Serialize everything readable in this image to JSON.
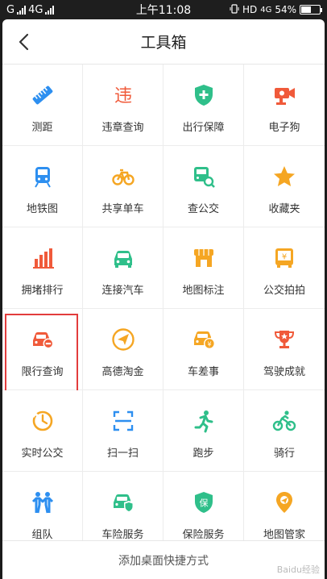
{
  "status_bar": {
    "carrier_left": "G",
    "network": "4G",
    "time": "上午11:08",
    "hd": "HD",
    "network_right": "4G",
    "battery_level_percent": 54,
    "battery_label": "54%"
  },
  "navbar": {
    "title": "工具箱",
    "back_icon": "chevron-left-icon"
  },
  "tools": [
    {
      "label": "测距",
      "icon": "ruler-icon",
      "color": "#2d8ff0"
    },
    {
      "label": "违章查询",
      "icon": "violation-icon",
      "color": "#f05a3a"
    },
    {
      "label": "出行保障",
      "icon": "shield-plus-icon",
      "color": "#2fbf8a"
    },
    {
      "label": "电子狗",
      "icon": "camera-icon",
      "color": "#f05a3a"
    },
    {
      "label": "地铁图",
      "icon": "metro-icon",
      "color": "#2d8ff0"
    },
    {
      "label": "共享单车",
      "icon": "bicycle-icon",
      "color": "#f5a623"
    },
    {
      "label": "查公交",
      "icon": "bus-search-icon",
      "color": "#2fbf8a"
    },
    {
      "label": "收藏夹",
      "icon": "star-icon",
      "color": "#f5a623"
    },
    {
      "label": "拥堵排行",
      "icon": "bar-chart-icon",
      "color": "#f05a3a"
    },
    {
      "label": "连接汽车",
      "icon": "car-icon",
      "color": "#2fbf8a"
    },
    {
      "label": "地图标注",
      "icon": "shop-icon",
      "color": "#f5a623"
    },
    {
      "label": "公交拍拍",
      "icon": "bus-yuan-icon",
      "color": "#f5a623"
    },
    {
      "label": "限行查询",
      "icon": "car-restrict-icon",
      "color": "#f05a3a"
    },
    {
      "label": "高德淘金",
      "icon": "send-icon",
      "color": "#f5a623"
    },
    {
      "label": "车差事",
      "icon": "car-yuan-icon",
      "color": "#f5a623"
    },
    {
      "label": "驾驶成就",
      "icon": "trophy-icon",
      "color": "#f05a3a"
    },
    {
      "label": "实时公交",
      "icon": "clock-icon",
      "color": "#f5a623"
    },
    {
      "label": "扫一扫",
      "icon": "scan-icon",
      "color": "#2d8ff0"
    },
    {
      "label": "跑步",
      "icon": "runner-icon",
      "color": "#2fbf8a"
    },
    {
      "label": "骑行",
      "icon": "cyclist-icon",
      "color": "#2fbf8a"
    },
    {
      "label": "组队",
      "icon": "team-icon",
      "color": "#2d8ff0"
    },
    {
      "label": "车险服务",
      "icon": "car-shield-icon",
      "color": "#2fbf8a"
    },
    {
      "label": "保险服务",
      "icon": "insurance-icon",
      "color": "#2fbf8a"
    },
    {
      "label": "地图管家",
      "icon": "map-pin-icon",
      "color": "#f5a623"
    }
  ],
  "bottom_bar": {
    "label": "添加桌面快捷方式"
  },
  "watermark": "Baidu经验"
}
